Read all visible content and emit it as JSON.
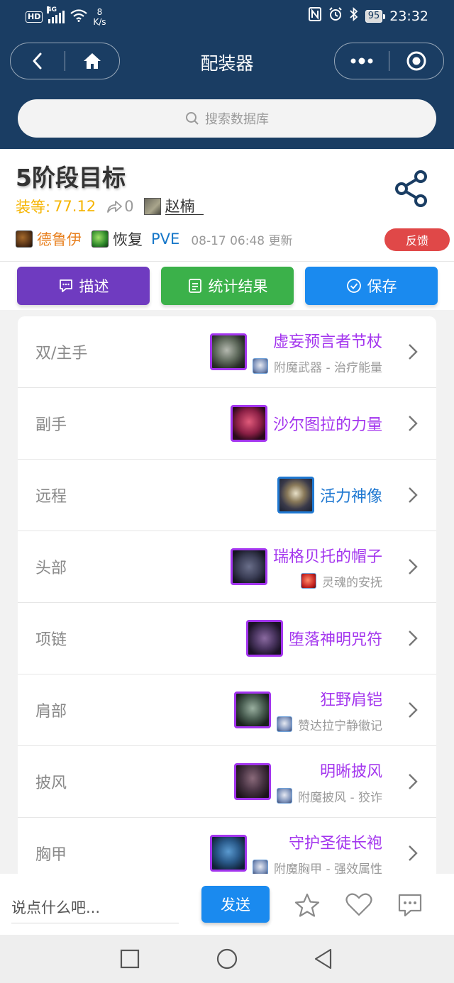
{
  "status_bar": {
    "hd": "HD",
    "network": "4G",
    "speed_value": "8",
    "speed_unit": "K/s",
    "battery": "95",
    "time": "23:32"
  },
  "nav": {
    "title": "配装器"
  },
  "search": {
    "placeholder": "搜索数据库"
  },
  "build": {
    "title": "5阶段目标",
    "ilvl_label": "装等:",
    "ilvl_value": "77.12",
    "fork_count": "0",
    "author": "赵楠",
    "class_name": "德鲁伊",
    "spec_name": "恢复",
    "mode": "PVE",
    "updated_time": "08-17 06:48",
    "updated_suffix": "更新",
    "feedback_label": "反馈"
  },
  "actions": {
    "describe": "描述",
    "stats": "统计结果",
    "save": "保存"
  },
  "slots": [
    {
      "slot": "双/主手",
      "item": "虚妄预言者节杖",
      "quality": "epic",
      "sub": "附魔武器 - 治疗能量",
      "icon": "staff-icon",
      "ench": "scroll"
    },
    {
      "slot": "副手",
      "item": "沙尔图拉的力量",
      "quality": "epic",
      "sub": "",
      "icon": "offhand-icon",
      "ench": ""
    },
    {
      "slot": "远程",
      "item": "活力神像",
      "quality": "rare",
      "sub": "",
      "icon": "idol-icon",
      "ench": ""
    },
    {
      "slot": "头部",
      "item": "瑞格贝托的帽子",
      "quality": "epic",
      "sub": "灵魂的安抚",
      "icon": "hat-icon",
      "ench": "gem"
    },
    {
      "slot": "项链",
      "item": "堕落神明咒符",
      "quality": "epic",
      "sub": "",
      "icon": "amulet-icon",
      "ench": ""
    },
    {
      "slot": "肩部",
      "item": "狂野肩铠",
      "quality": "epic",
      "sub": "赞达拉宁静徽记",
      "icon": "shoulder-icon",
      "ench": "scroll"
    },
    {
      "slot": "披风",
      "item": "明晰披风",
      "quality": "epic",
      "sub": "附魔披风 - 狡诈",
      "icon": "cloak-icon",
      "ench": "scroll"
    },
    {
      "slot": "胸甲",
      "item": "守护圣徒长袍",
      "quality": "epic",
      "sub": "附魔胸甲 - 强效属性",
      "icon": "robe-icon",
      "ench": "scroll"
    }
  ],
  "bottom": {
    "comment_placeholder": "说点什么吧...",
    "send_label": "发送"
  },
  "colors": {
    "header_bg": "#1a3d63",
    "epic": "#a335ee",
    "rare": "#1f78d1",
    "ilvl": "#f5b400",
    "druid": "#e8801f",
    "describe_btn": "#6f3bc0",
    "stats_btn": "#3bb14a",
    "save_btn": "#1a8aef",
    "feedback_btn": "#e04848"
  }
}
